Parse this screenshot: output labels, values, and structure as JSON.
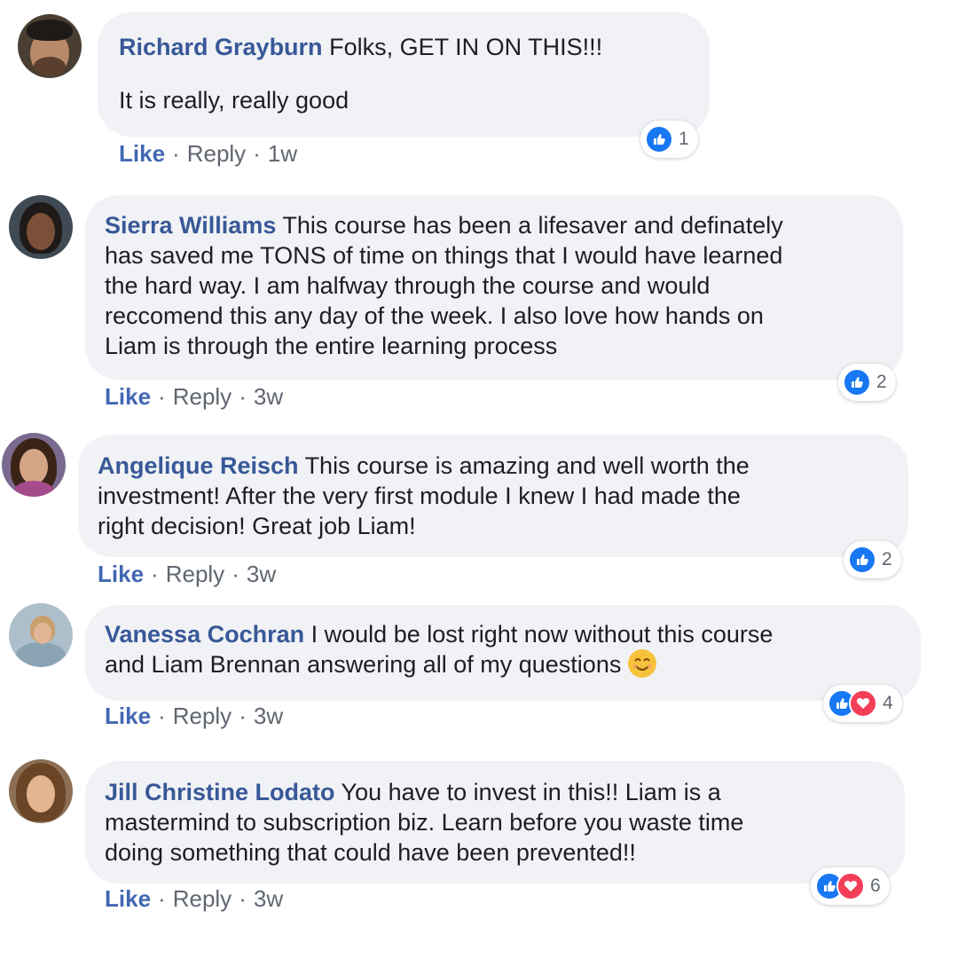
{
  "comments": [
    {
      "author": "Richard Grayburn",
      "lines": [
        "Folks, GET IN ON THIS!!!",
        "It is really, really good"
      ],
      "like_label": "Like",
      "reply_label": "Reply",
      "time": "1w",
      "reaction_count": "1",
      "reactions": [
        "like"
      ]
    },
    {
      "author": "Sierra Williams",
      "lines": [
        "This course has been a lifesaver and definately",
        "has saved me TONS of time on things that I would have learned",
        "the hard way. I am halfway through the course and would",
        "reccomend this any day of the week. I also love how hands on",
        "Liam is through the entire learning process"
      ],
      "like_label": "Like",
      "reply_label": "Reply",
      "time": "3w",
      "reaction_count": "2",
      "reactions": [
        "like"
      ]
    },
    {
      "author": "Angelique Reisch",
      "lines": [
        "This course is amazing and well worth the",
        "investment! After the very first module I knew I had made the",
        "right decision! Great job Liam!"
      ],
      "like_label": "Like",
      "reply_label": "Reply",
      "time": "3w",
      "reaction_count": "2",
      "reactions": [
        "like"
      ]
    },
    {
      "author": "Vanessa Cochran",
      "lines": [
        "I would be lost right now without this course",
        "and Liam Brennan answering all of my questions"
      ],
      "emoji": "smiling-face-emoji",
      "like_label": "Like",
      "reply_label": "Reply",
      "time": "3w",
      "reaction_count": "4",
      "reactions": [
        "like",
        "love"
      ]
    },
    {
      "author": "Jill Christine Lodato",
      "lines": [
        "You have to invest in this!! Liam is a",
        "mastermind to subscription biz. Learn before you waste time",
        "doing something that could have been prevented!!"
      ],
      "like_label": "Like",
      "reply_label": "Reply",
      "time": "3w",
      "reaction_count": "6",
      "reactions": [
        "like",
        "love"
      ]
    }
  ],
  "separator": "·",
  "colors": {
    "author": "#385898",
    "like_action": "#4267b2",
    "bubble": "#f0f2f5",
    "like_reaction": "#1877f2",
    "love_reaction": "#f33e58"
  }
}
